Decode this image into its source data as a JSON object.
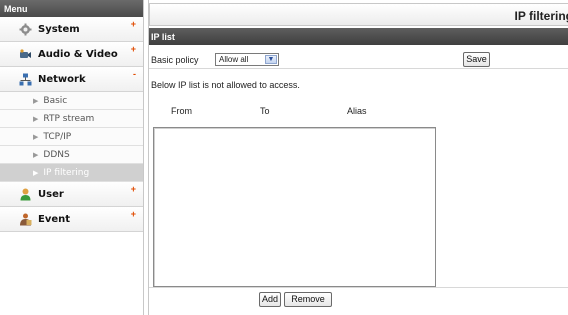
{
  "sidebar": {
    "title": "Menu",
    "items": [
      {
        "label": "System",
        "sign": "+",
        "icon": "gear-icon"
      },
      {
        "label": "Audio & Video",
        "sign": "+",
        "icon": "camera-icon"
      },
      {
        "label": "Network",
        "sign": "-",
        "icon": "network-icon"
      },
      {
        "label": "User",
        "sign": "+",
        "icon": "user-icon"
      },
      {
        "label": "Event",
        "sign": "+",
        "icon": "event-icon"
      }
    ],
    "network_sub": [
      "Basic",
      "RTP stream",
      "TCP/IP",
      "DDNS",
      "IP filtering"
    ],
    "active_sub": "IP filtering"
  },
  "page": {
    "title": "IP filtering",
    "section": "IP list",
    "policy_label": "Basic policy",
    "policy_value": "Allow all",
    "save_label": "Save",
    "note": "Below IP list is not allowed to access.",
    "columns": [
      "From",
      "To",
      "Alias"
    ],
    "add_label": "Add",
    "remove_label": "Remove"
  },
  "colors": {
    "header_dark": "#4a4a4a",
    "plus_sign": "#e04a00",
    "active_sub_bg": "#d0d0d0"
  }
}
